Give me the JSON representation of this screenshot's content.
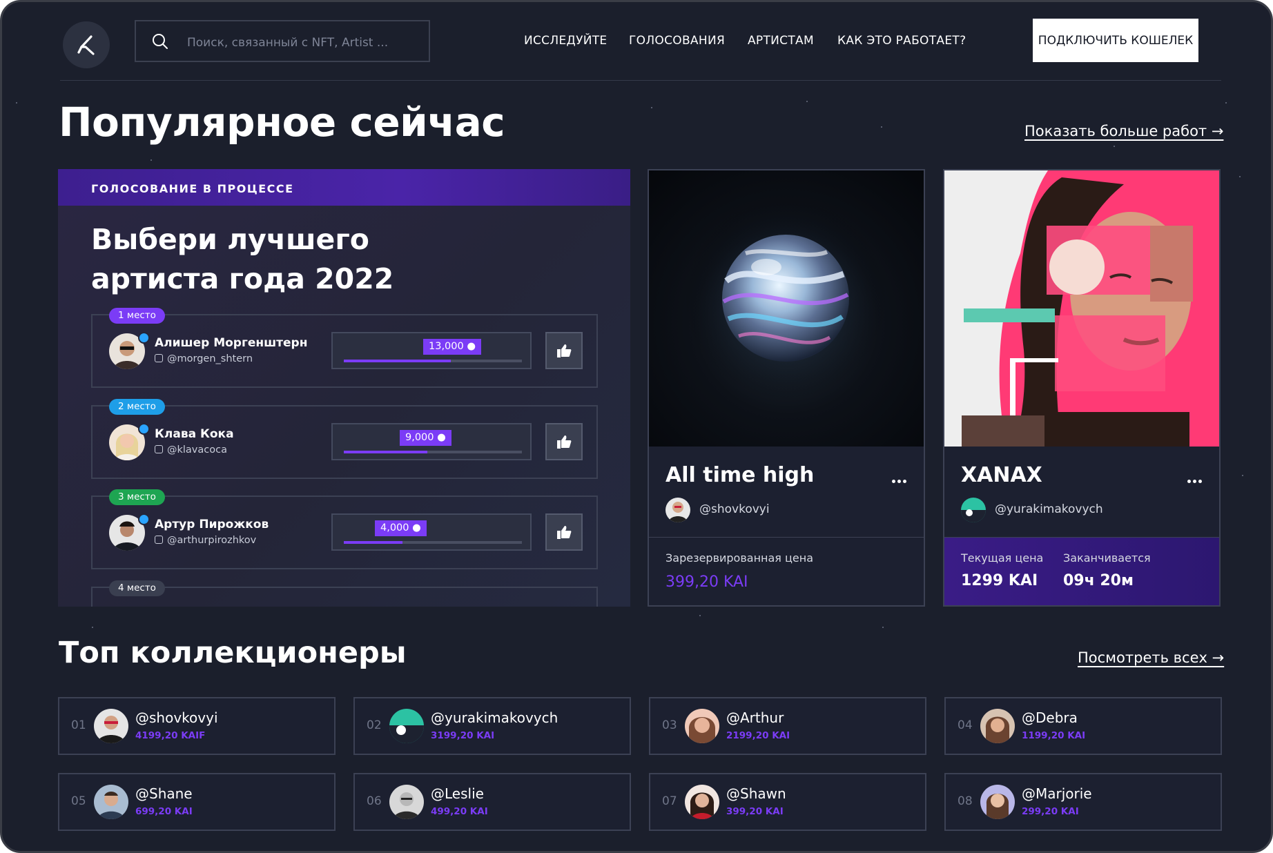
{
  "header": {
    "search_placeholder": "Поиск, связанный с NFT, Artist ...",
    "nav": [
      "ИССЛЕДУЙТЕ",
      "ГОЛОСОВАНИЯ",
      "АРТИСТАМ",
      "КАК ЭТО РАБОТАЕТ?"
    ],
    "connect_label": "ПОДКЛЮЧИТЬ КОШЕЛЕК"
  },
  "popular": {
    "title": "Популярное сейчас",
    "more_label": "Показать больше работ →"
  },
  "vote": {
    "status": "ГОЛОСОВАНИЕ В ПРОЦЕССЕ",
    "title_line1": "Выбери лучшего",
    "title_line2": "артиста года 2022",
    "entries": [
      {
        "place": "1 место",
        "name": "Алишер Моргенштерн",
        "handle": "@morgen_shtern",
        "votes": "13,000",
        "progress": 0.6,
        "badge_color": "#7b3cf6"
      },
      {
        "place": "2 место",
        "name": "Клава Кока",
        "handle": "@klavacoca",
        "votes": "9,000",
        "progress": 0.47,
        "badge_color": "#1e9ee8"
      },
      {
        "place": "3 место",
        "name": "Артур Пирожков",
        "handle": "@arthurpirozhkov",
        "votes": "4,000",
        "progress": 0.33,
        "badge_color": "#1ea552"
      },
      {
        "place": "4 место",
        "name": "",
        "handle": "",
        "votes": "",
        "progress": 0,
        "badge_color": "#3a3f50"
      }
    ]
  },
  "cards": [
    {
      "title": "All time high",
      "author": "@shovkovyi",
      "price_label": "Зарезервированная цена",
      "price": "399,20 KAI"
    },
    {
      "title": "XANAX",
      "author": "@yurakimakovych",
      "price_label": "Текущая цена",
      "price": "1299 KAI",
      "ends_label": "Заканчивается",
      "ends": "09ч 20м"
    }
  ],
  "collectors": {
    "title": "Топ коллекционеры",
    "more_label": "Посмотреть всех →",
    "items": [
      {
        "rank": "01",
        "name": "@shovkovyi",
        "amount": "4199,20 KAIF"
      },
      {
        "rank": "02",
        "name": "@yurakimakovych",
        "amount": "3199,20 KAI"
      },
      {
        "rank": "03",
        "name": "@Arthur",
        "amount": "2199,20 KAI"
      },
      {
        "rank": "04",
        "name": "@Debra",
        "amount": "1199,20 KAI"
      },
      {
        "rank": "05",
        "name": "@Shane",
        "amount": "699,20 KAI"
      },
      {
        "rank": "06",
        "name": "@Leslie",
        "amount": "499,20 KAI"
      },
      {
        "rank": "07",
        "name": "@Shawn",
        "amount": "399,20 KAI"
      },
      {
        "rank": "08",
        "name": "@Marjorie",
        "amount": "299,20 KAI"
      }
    ]
  },
  "colors": {
    "accent": "#7b3cf6",
    "background": "#1b1f2c",
    "pink": "#ff3a75"
  }
}
